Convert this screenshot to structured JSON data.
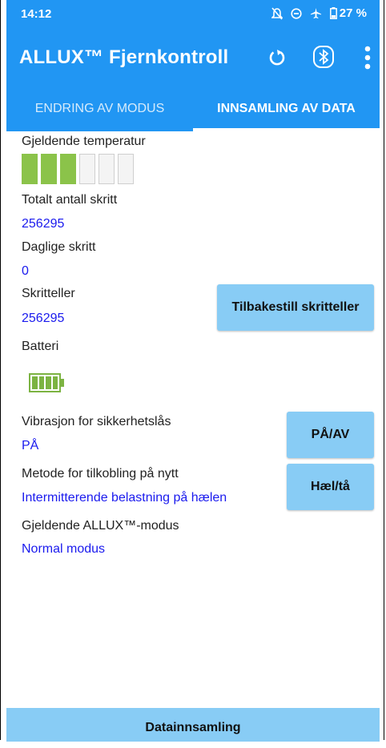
{
  "status_bar": {
    "time": "14:12",
    "battery_percent": "27 %",
    "icons": [
      "bell-off-icon",
      "do-not-disturb-icon",
      "airplane-icon",
      "battery-icon"
    ]
  },
  "app_bar": {
    "title": "ALLUX™ Fjernkontroll",
    "icons": [
      "sync-icon",
      "bluetooth-icon",
      "more-vert-icon"
    ],
    "color": "#2196f3"
  },
  "tabs": [
    {
      "label": "ENDRING AV MODUS",
      "active": false
    },
    {
      "label": "INNSAMLING AV DATA",
      "active": true
    }
  ],
  "temperature": {
    "label": "Gjeldende temperatur",
    "level": 3,
    "max": 6,
    "active_color": "#8bc34a"
  },
  "total_steps": {
    "label": "Totalt antall skritt",
    "value": "256295"
  },
  "daily_steps": {
    "label": "Daglige skritt",
    "value": "0"
  },
  "step_counter": {
    "label": "Skritteller",
    "value": "256295",
    "reset_button": "Tilbakestill skritteller"
  },
  "battery": {
    "label": "Batteri",
    "level_fraction": 1.0,
    "color": "#7cb342"
  },
  "vibration": {
    "label": "Vibrasjon for sikkerhetslås",
    "value": "PÅ",
    "button": "PÅ/AV"
  },
  "reconnect": {
    "label": "Metode for tilkobling på nytt",
    "value": "Intermitterende belastning på hælen",
    "button": "Hæl/tå"
  },
  "mode": {
    "label": "Gjeldende ALLUX™-modus",
    "value": "Normal modus"
  },
  "bottom_bar": {
    "label": "Datainnsamling"
  }
}
